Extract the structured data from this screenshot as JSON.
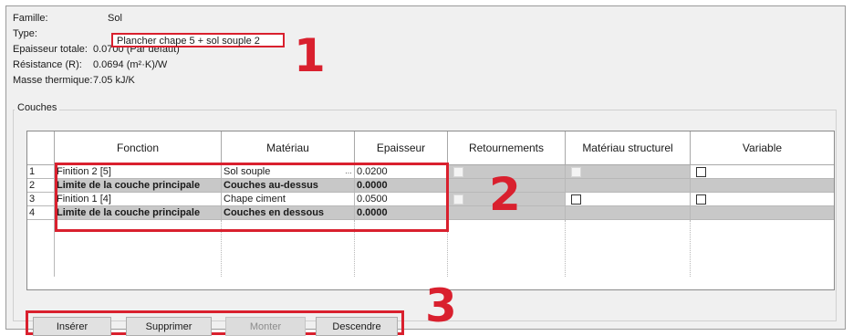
{
  "properties": {
    "famille": {
      "label": "Famille:",
      "value": "Sol"
    },
    "type": {
      "label": "Type:",
      "value": "Plancher chape 5 + sol souple 2"
    },
    "epaisseur": {
      "label": "Epaisseur totale:",
      "value": "0.0700 (Par défaut)"
    },
    "resistance": {
      "label": "Résistance (R):",
      "value": "0.0694 (m²·K)/W"
    },
    "masse": {
      "label": "Masse thermique:",
      "value": "7.05 kJ/K"
    }
  },
  "group_title": "Couches",
  "table": {
    "headers": [
      "Fonction",
      "Matériau",
      "Epaisseur",
      "Retournements",
      "Matériau structurel",
      "Variable"
    ],
    "rows": [
      {
        "num": "1",
        "fonction": "Finition 2 [5]",
        "materiau": "Sol souple",
        "epaisseur": "0.0200",
        "bold": false
      },
      {
        "num": "2",
        "fonction": "Limite de la couche principale",
        "materiau": "Couches au-dessus",
        "epaisseur": "0.0000",
        "bold": true
      },
      {
        "num": "3",
        "fonction": "Finition 1 [4]",
        "materiau": "Chape ciment",
        "epaisseur": "0.0500",
        "bold": false
      },
      {
        "num": "4",
        "fonction": "Limite de la couche principale",
        "materiau": "Couches en dessous",
        "epaisseur": "0.0000",
        "bold": true
      }
    ],
    "ellipsis": "..."
  },
  "buttons": {
    "inserer": "Insérer",
    "supprimer": "Supprimer",
    "monter": "Monter",
    "descendre": "Descendre"
  },
  "annotations": {
    "n1": "1",
    "n2": "2",
    "n3": "3"
  },
  "colors": {
    "highlight": "#d9202e",
    "row_shade": "#c8c8c8"
  }
}
